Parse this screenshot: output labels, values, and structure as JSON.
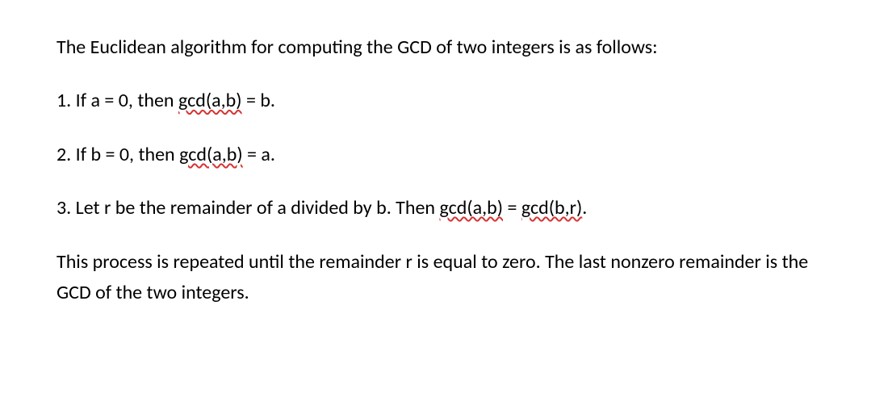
{
  "intro": "The Euclidean algorithm for computing the GCD of two integers is as follows:",
  "step1": {
    "prefix": "1. If a = 0, then ",
    "gcd": "gcd(a,b)",
    "suffix": " = b."
  },
  "step2": {
    "prefix": "2. If b = 0, then ",
    "gcd": "gcd(a,b)",
    "suffix": " = a."
  },
  "step3": {
    "prefix": "3. Let r be the remainder of a divided by b. Then ",
    "gcd1": "gcd(a,b)",
    "equals": " = ",
    "gcd2": "gcd(b,r)",
    "suffix": "."
  },
  "conclusion": "This process is repeated until the remainder r is equal to zero. The last nonzero remainder is the GCD of the two integers."
}
